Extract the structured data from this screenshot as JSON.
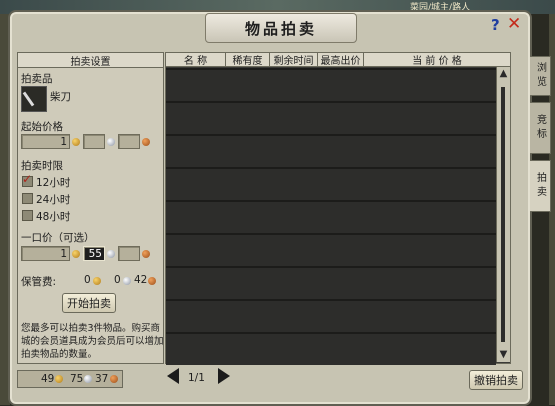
{
  "top_info": "菜园/城主/路人",
  "title": "物品拍卖",
  "left": {
    "header": "拍卖设置",
    "item_label": "拍卖品",
    "item_name": "柴刀",
    "start_price_label": "起始价格",
    "start_price_gold": "1",
    "start_price_silver": "",
    "start_price_copper": "",
    "duration_label": "拍卖时限",
    "durations": [
      {
        "label": "12小时",
        "checked": true
      },
      {
        "label": "24小时",
        "checked": false
      },
      {
        "label": "48小时",
        "checked": false
      }
    ],
    "buyout_label": "一口价（可选）",
    "buyout_gold": "1",
    "buyout_silver": "55",
    "buyout_copper": "",
    "fee_label": "保管费:",
    "fee_gold": "0",
    "fee_silver": "0",
    "fee_copper": "42",
    "start_button": "开始拍卖",
    "note": "您最多可以拍卖3件物品。购买商城的会员道具成为会员后可以增加拍卖物品的数量。"
  },
  "table": {
    "columns": [
      "名 称",
      "稀有度",
      "剩余时间",
      "最高出价",
      "当 前 价 格"
    ]
  },
  "tabs": [
    "浏览",
    "竞标",
    "拍卖"
  ],
  "active_tab": "拍卖",
  "money": {
    "gold": "49",
    "silver": "75",
    "copper": "37"
  },
  "pager": "1/1",
  "cancel_button": "撤销拍卖",
  "colors": {
    "gold": "#c89a2a",
    "silver": "#b8bcc6",
    "copper": "#b8682a",
    "check": "#b0241a"
  }
}
